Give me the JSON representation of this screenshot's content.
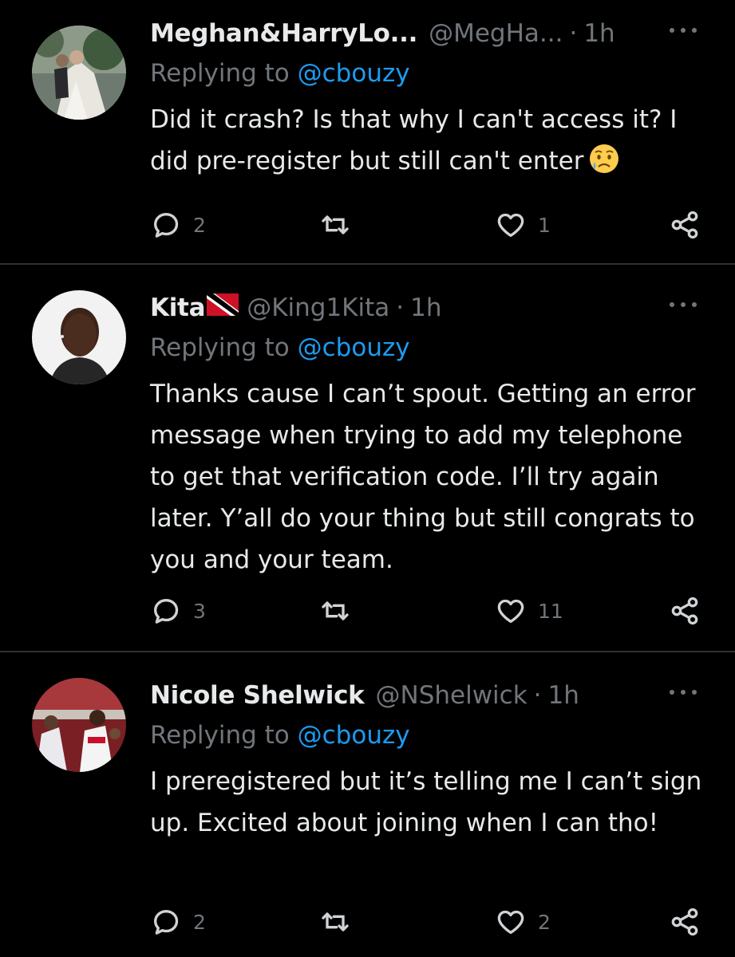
{
  "replies": [
    {
      "name": "Meghan&HarryLo...",
      "handle": "@MegHa...",
      "dot": "·",
      "time": "1h",
      "replying_prefix": "Replying to ",
      "replying_to": "@cbouzy",
      "text": "Did it crash? Is that why I can't access it? I did pre-register but still can't enter",
      "emoji": "crying-face-emoji",
      "reply_count": "2",
      "retweet_count": "",
      "like_count": "1"
    },
    {
      "name": "Kita",
      "flag": "trinidad-and-tobago-flag",
      "handle": "@King1Kita",
      "dot": "·",
      "time": "1h",
      "replying_prefix": "Replying to ",
      "replying_to": "@cbouzy",
      "text": "Thanks cause I can’t spout. Getting an error message when trying to add my telephone to get that verification code. I’ll try again later. Y’all do your thing but still congrats to you and your team.",
      "reply_count": "3",
      "retweet_count": "",
      "like_count": "11"
    },
    {
      "name": "Nicole Shelwick",
      "handle": "@NShelwick",
      "dot": "·",
      "time": "1h",
      "replying_prefix": "Replying to ",
      "replying_to": "@cbouzy",
      "text": "I preregistered but it’s telling me I can’t sign up. Excited about joining when I can tho!",
      "reply_count": "2",
      "retweet_count": "",
      "like_count": "2"
    }
  ],
  "colors": {
    "background": "#000000",
    "text": "#e7e9ea",
    "secondary": "#71767b",
    "link": "#1d9bf0",
    "divider": "#2f3336"
  }
}
